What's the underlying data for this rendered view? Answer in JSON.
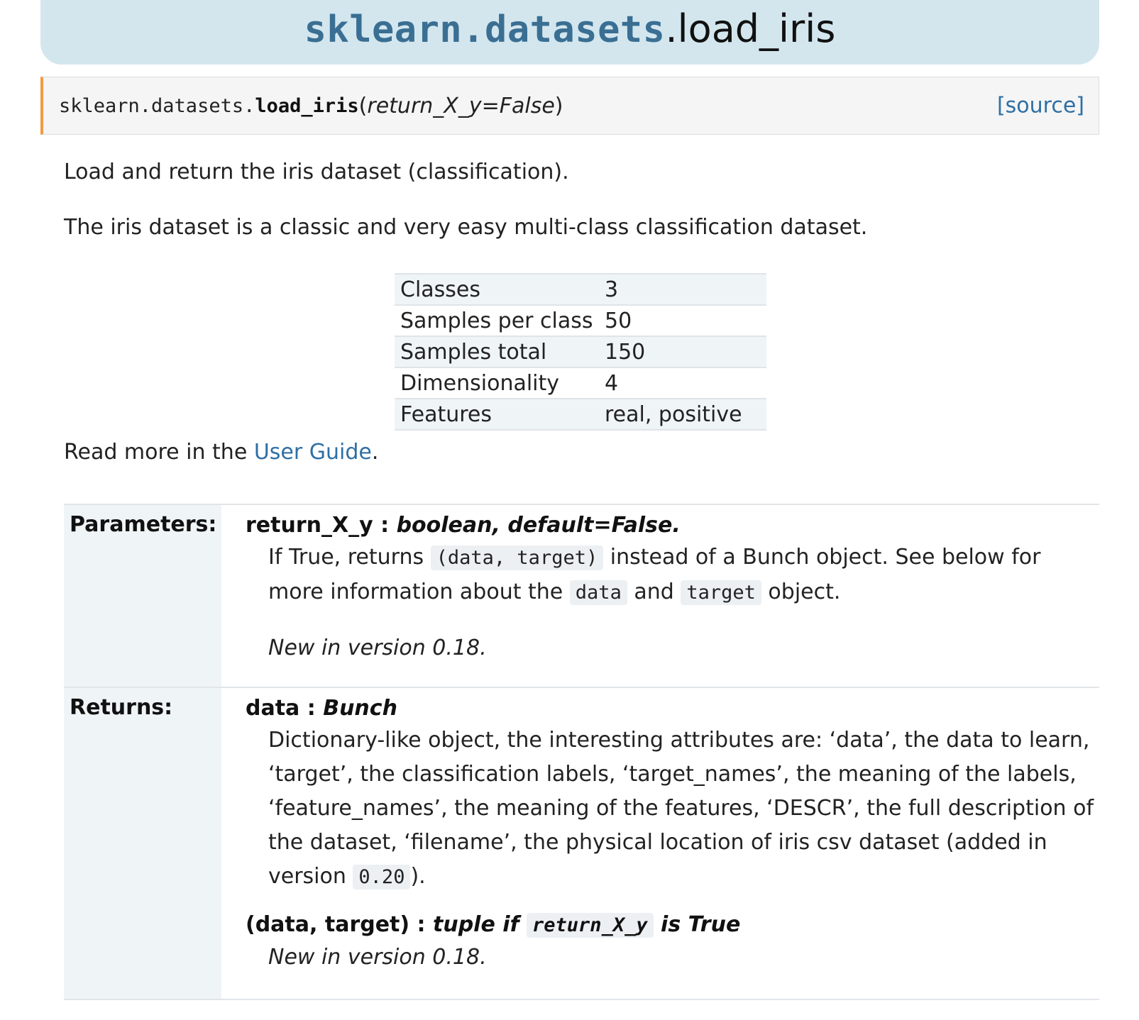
{
  "title": {
    "module": "sklearn.datasets",
    "function": ".load_iris"
  },
  "signature": {
    "module": "sklearn.datasets.",
    "name": "load_iris",
    "open_paren": "(",
    "params": "return_X_y=False",
    "close_paren": ")",
    "source_link": "[source]"
  },
  "intro": {
    "summary": "Load and return the iris dataset (classification).",
    "detail": "The iris dataset is a classic and very easy multi-class classification dataset."
  },
  "info_table": [
    {
      "key": "Classes",
      "value": "3"
    },
    {
      "key": "Samples per class",
      "value": "50"
    },
    {
      "key": "Samples total",
      "value": "150"
    },
    {
      "key": "Dimensionality",
      "value": "4"
    },
    {
      "key": "Features",
      "value": "real, positive"
    }
  ],
  "read_more": {
    "prefix": "Read more in the ",
    "link": "User Guide",
    "suffix": "."
  },
  "parameters": {
    "label": "Parameters:",
    "name": "return_X_y",
    "sep": " : ",
    "type": "boolean, default=False.",
    "desc_1": "If True, returns ",
    "code_1": "(data, target)",
    "desc_2": " instead of a Bunch object. See below for more information about the ",
    "code_2": "data",
    "desc_3": " and ",
    "code_3": "target",
    "desc_4": " object.",
    "version_note": "New in version 0.18."
  },
  "returns": {
    "label": "Returns:",
    "item1": {
      "name": "data",
      "sep": " : ",
      "type": "Bunch",
      "desc": "Dictionary-like object, the interesting attributes are: ‘data’, the data to learn, ‘target’, the classification labels, ‘target_names’, the meaning of the labels, ‘feature_names’, the meaning of the features, ‘DESCR’, the full description of the dataset, ‘filename’, the physical location of iris csv dataset (added in version ",
      "code": "0.20",
      "desc_end": ")."
    },
    "item2": {
      "name": "(data, target)",
      "sep": " : ",
      "type_1": "tuple if ",
      "code": "return_X_y",
      "type_2": " is True",
      "version_note": "New in version 0.18."
    }
  }
}
